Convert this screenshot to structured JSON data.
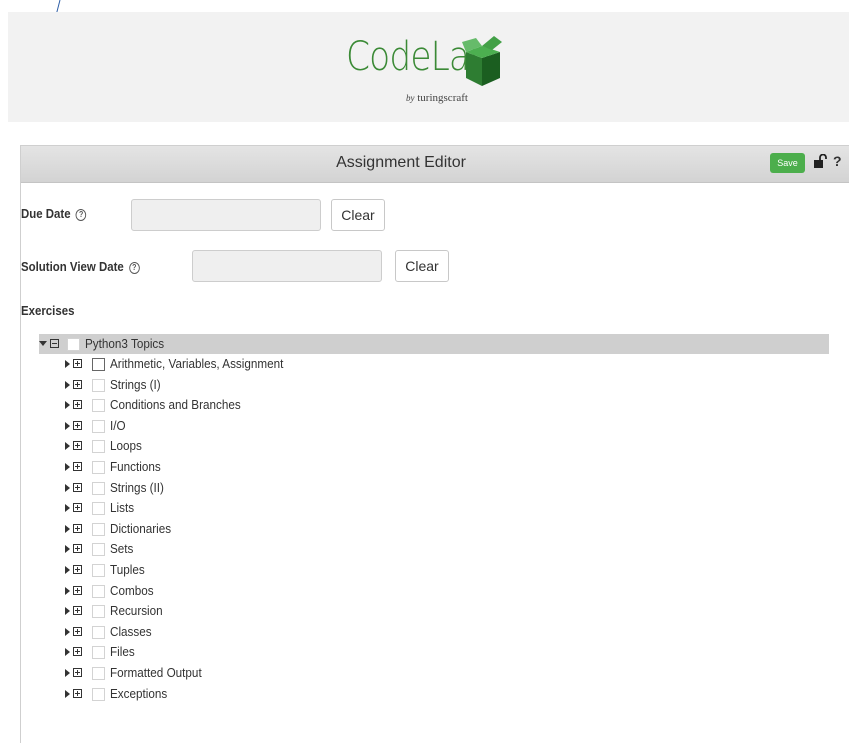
{
  "brand": {
    "logo_text": "CodeLab",
    "byline_prefix": "by",
    "byline_name": "turingscraft"
  },
  "editor": {
    "title": "Assignment Editor",
    "save_label": "Save",
    "help_label": "?"
  },
  "due_date": {
    "label": "Due Date",
    "value": "",
    "clear_label": "Clear"
  },
  "solution_date": {
    "label": "Solution View Date",
    "value": "",
    "clear_label": "Clear"
  },
  "exercises": {
    "label": "Exercises",
    "root": {
      "label": "Python3 Topics"
    },
    "topics": [
      {
        "label": "Arithmetic, Variables, Assignment"
      },
      {
        "label": "Strings (I)"
      },
      {
        "label": "Conditions and Branches"
      },
      {
        "label": "I/O"
      },
      {
        "label": "Loops"
      },
      {
        "label": "Functions"
      },
      {
        "label": "Strings (II)"
      },
      {
        "label": "Lists"
      },
      {
        "label": "Dictionaries"
      },
      {
        "label": "Sets"
      },
      {
        "label": "Tuples"
      },
      {
        "label": "Combos"
      },
      {
        "label": "Recursion"
      },
      {
        "label": "Classes"
      },
      {
        "label": "Files"
      },
      {
        "label": "Formatted Output"
      },
      {
        "label": "Exceptions"
      }
    ]
  },
  "colors": {
    "brand_green": "#3b8a36",
    "save_green": "#4cae4c",
    "annotation_line": "#2f5fa8"
  }
}
